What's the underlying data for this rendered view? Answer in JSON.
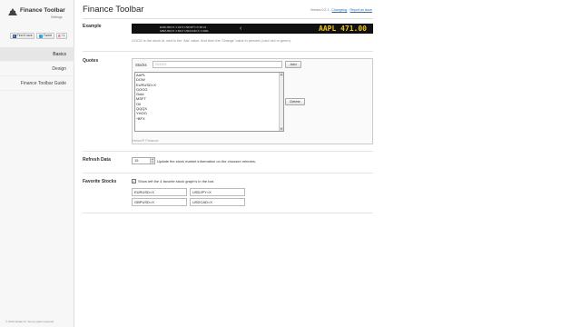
{
  "sidebar": {
    "logo_title": "Finance Toolbar",
    "logo_subtitle": "Settings",
    "social": [
      {
        "label": "Find it lack",
        "icon": "facebook-icon"
      },
      {
        "label": "Tweet",
        "icon": "twitter-icon"
      },
      {
        "label": "+1",
        "icon": "google-plus-icon"
      }
    ],
    "nav": [
      {
        "label": "Basics",
        "active": true
      },
      {
        "label": "Design",
        "active": false
      },
      {
        "label": "Finance Toolbar Guide",
        "active": false
      }
    ],
    "copyright": "© 2013 Sidder.cc. Some rights reserved"
  },
  "header": {
    "title": "Finance Toolbar",
    "version": "Version 0.2.1 -",
    "changelog": "Changelog",
    "report": "Report an issue"
  },
  "example": {
    "label": "Example",
    "ticker_left_top": "EURUSD=X 1.3472    USDJPY=X 98.21",
    "ticker_left_bottom": "GBPUSD=X 1.5617    USDCAD=X 1.0301",
    "ticker_big": "AAPL 471.00",
    "description": "GOOG is the stock id, next is the 'Ask' value. And then the 'Change' value in percent (color red or green)."
  },
  "quotes": {
    "label": "Quotes",
    "stocks_label": "Stocks",
    "stocks_placeholder": "GOOG",
    "add_button": "Add",
    "delete_button": "Delete",
    "list": [
      "AAPL",
      "DOW",
      "EURUSD=X",
      "GOOG",
      "Gold",
      "MSFT",
      "Oil",
      "QQQX",
      "YHOO",
      "^BFX"
    ],
    "source": "Yahoo® Finance"
  },
  "refresh": {
    "label": "Refresh Data",
    "value": "15",
    "description": "Update the stock market information on the choosen minutes."
  },
  "favorites": {
    "label": "Favorite Stocks",
    "checkbox_label": "Show left the 4 favorite stock graph's in the bar.",
    "checked": true,
    "inputs": [
      "EURUSD=X",
      "USDJPY=X",
      "GBPUSD=X",
      "USDCAD=X"
    ]
  }
}
